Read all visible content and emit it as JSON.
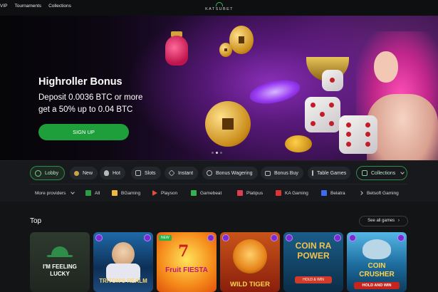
{
  "nav": {
    "items": [
      "VIP",
      "Tournaments",
      "Collections"
    ]
  },
  "logo": {
    "text": "KATSUBET"
  },
  "hero": {
    "title": "Highroller Bonus",
    "line1": "Deposit 0.0036 BTC or more",
    "line2": "get a 50% up to 0.04 BTC",
    "button": "SIGN UP",
    "slide_count": 3,
    "active_slide": 2
  },
  "categories": {
    "lobby": "Lobby",
    "items": [
      "New",
      "Hot",
      "Slots",
      "Instant",
      "Bonus Wagering",
      "Bonus Buy",
      "Table Games"
    ],
    "collections": "Collections"
  },
  "providers": {
    "more": "More providers",
    "items": [
      "All",
      "BGaming",
      "Playson",
      "Gamebeat",
      "Platipus",
      "KA Gaming",
      "Belatra",
      "Betsoft Gaming"
    ]
  },
  "top": {
    "title": "Top",
    "see_all": "See all games",
    "games": [
      "I'M FEELING LUCKY",
      "TRITON'S REALM",
      "Fruit FIESTA",
      "WILD TIGER",
      "COIN RA POWER",
      "COIN CRUSHER"
    ],
    "tags": {
      "new": "NEW"
    }
  },
  "colors": {
    "brand_green": "#1f9e3c",
    "accent_purple": "#7a2bd6",
    "bg": "#16181b"
  }
}
